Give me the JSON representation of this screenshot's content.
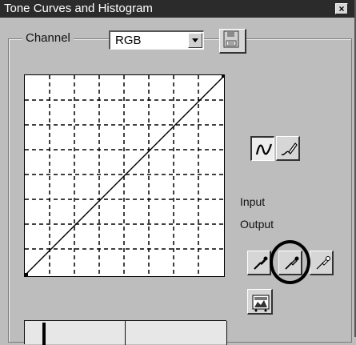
{
  "window": {
    "title": "Tone Curves and Histogram",
    "close_label": "×"
  },
  "channel": {
    "label": "Channel",
    "selected": "RGB"
  },
  "readouts": {
    "input_label": "Input",
    "output_label": "Output"
  },
  "icons": {
    "close": "close-icon",
    "dropdown": "chevron-down-icon",
    "save": "save-curve-icon",
    "smooth_curve": "smooth-curve-icon",
    "freehand_curve": "freehand-pencil-icon",
    "black_point": "black-eyedropper-icon",
    "gray_point": "gray-eyedropper-icon",
    "white_point": "white-eyedropper-icon",
    "auto_balance": "auto-balance-icon"
  },
  "colors": {
    "title_bar": "#2b2b2b",
    "dialog_face": "#bdbdbd",
    "graph_bg": "#ffffff"
  }
}
